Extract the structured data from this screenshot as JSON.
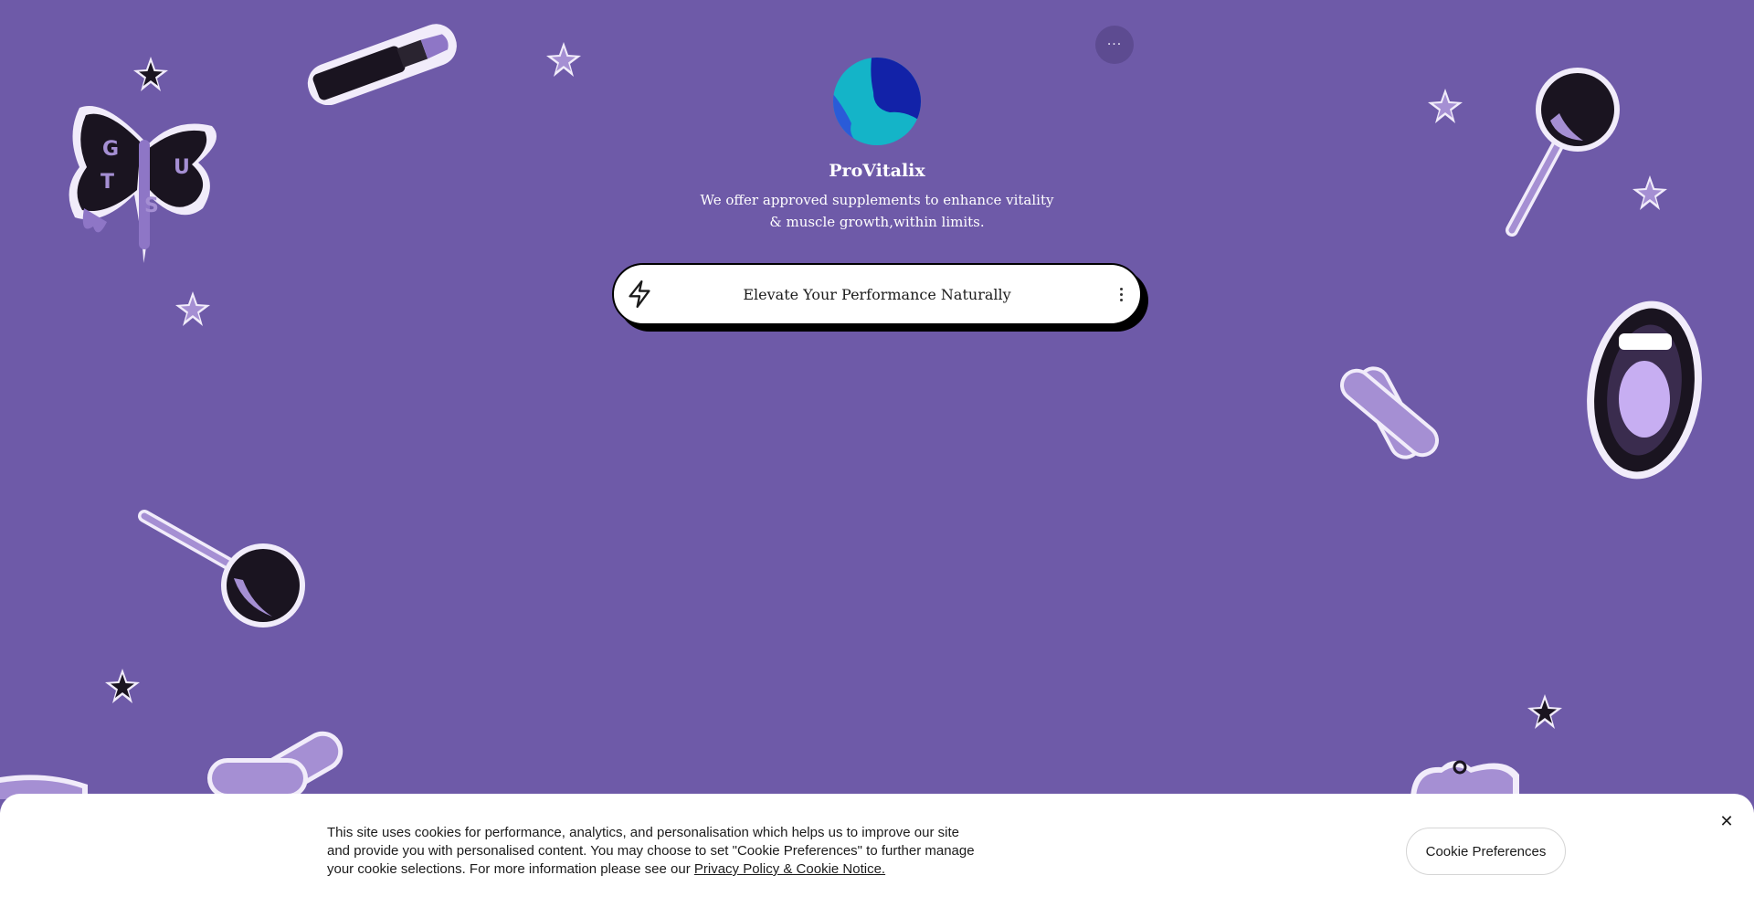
{
  "profile": {
    "name": "ProVitalix",
    "bio": "We offer approved supplements to enhance vitality & muscle growth,within limits.",
    "more_label": "···"
  },
  "links": [
    {
      "label": "Elevate Your Performance Naturally",
      "icon": "lightning-icon"
    }
  ],
  "cookie_banner": {
    "text": "This site uses cookies for performance, analytics, and personalisation which helps us to improve our site and provide you with personalised content. You may choose to set \"Cookie Preferences\" to further manage your cookie selections. For more information please see our ",
    "link_label": "Privacy Policy & Cookie Notice.",
    "preferences_label": "Cookie Preferences",
    "close_label": "✕"
  },
  "decor": {
    "butterfly_letters": [
      "G",
      "U",
      "T",
      "S"
    ]
  },
  "colors": {
    "background": "#6e5aa8",
    "sticker_purple": "#a58fd3",
    "sticker_dark": "#1a1420",
    "avatar_cyan": "#14b4c8",
    "avatar_blue": "#1222a8"
  }
}
